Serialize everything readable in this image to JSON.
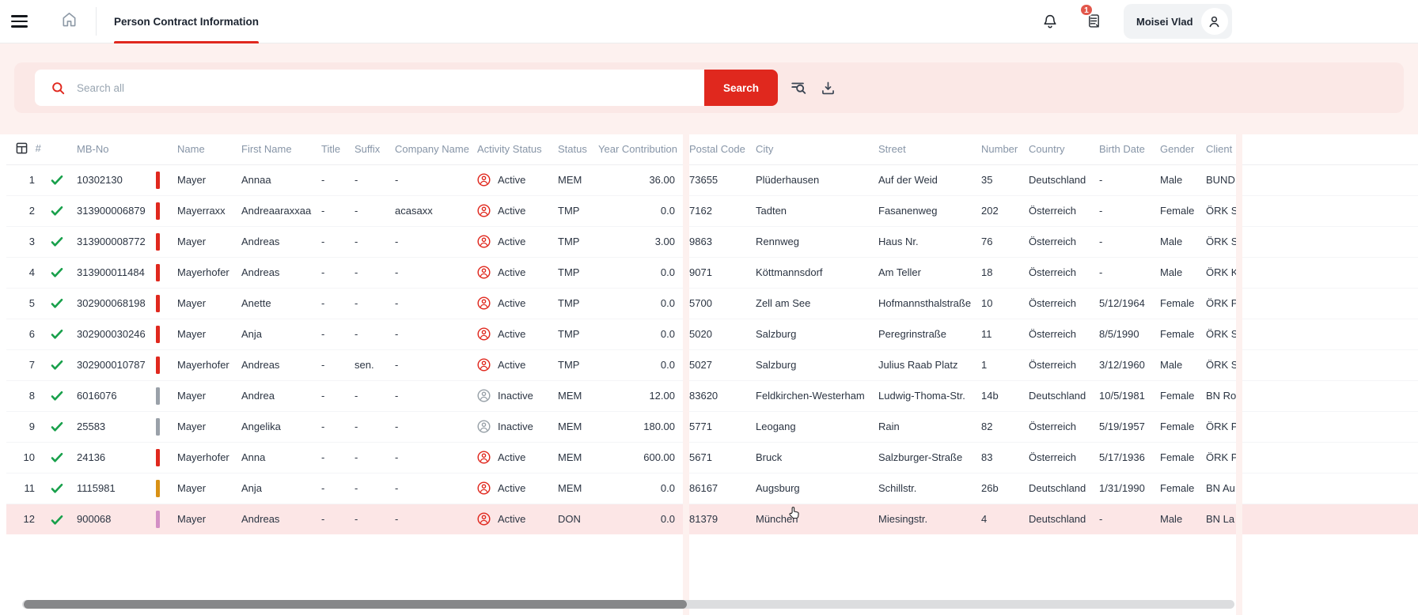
{
  "topbar": {
    "tab_label": "Person Contract Information",
    "user_name": "Moisei Vlad",
    "badge_count": "1"
  },
  "search": {
    "placeholder": "Search all",
    "button_label": "Search"
  },
  "icons": {
    "menu": "hamburger",
    "home": "house-outline",
    "notifications": "bell-outline",
    "tasks": "clipboard-list",
    "user": "person-circle",
    "search": "magnifier",
    "advanced_search": "list-magnifier",
    "download": "tray-arrow-down",
    "column_settings": "table-grid",
    "row_verified": "green-check",
    "activity": "person-in-circle"
  },
  "colors": {
    "accent": "#e0281e",
    "active_status": "#e0281e",
    "inactive_status": "#98a1a8",
    "check_green": "#18a04b",
    "row_highlight": "#fce6e6",
    "search_band": "#fdf1ef",
    "search_panel": "#fbe8e6"
  },
  "table": {
    "columns": [
      "#",
      "MB-No",
      "Name",
      "First Name",
      "Title",
      "Suffix",
      "Company Name",
      "Activity Status",
      "Status",
      "Year Contribution",
      "Postal Code",
      "City",
      "Street",
      "Number",
      "Country",
      "Birth Date",
      "Gender",
      "Client"
    ],
    "rows": [
      {
        "num": "1",
        "mb_no": "10302130",
        "bar_color": "#e0281e",
        "name": "Mayer",
        "first_name": "Annaa",
        "title": "-",
        "suffix": "-",
        "company": "-",
        "activity": "Active",
        "status": "MEM",
        "contribution": "36.00",
        "postal": "73655",
        "city": "Plüderhausen",
        "street": "Auf der Weid",
        "number": "35",
        "country": "Deutschland",
        "birth": "-",
        "gender": "Male",
        "client": "BUND",
        "highlight": false
      },
      {
        "num": "2",
        "mb_no": "313900006879",
        "bar_color": "#e0281e",
        "name": "Mayerraxx",
        "first_name": "Andreaaraxxaa",
        "title": "-",
        "suffix": "-",
        "company": "acasaxx",
        "activity": "Active",
        "status": "TMP",
        "contribution": "0.0",
        "postal": "7162",
        "city": "Tadten",
        "street": "Fasanenweg",
        "number": "202",
        "country": "Österreich",
        "birth": "-",
        "gender": "Female",
        "client": "ÖRK S",
        "highlight": false
      },
      {
        "num": "3",
        "mb_no": "313900008772",
        "bar_color": "#e0281e",
        "name": "Mayer",
        "first_name": "Andreas",
        "title": "-",
        "suffix": "-",
        "company": "-",
        "activity": "Active",
        "status": "TMP",
        "contribution": "3.00",
        "postal": "9863",
        "city": "Rennweg",
        "street": "Haus Nr.",
        "number": "76",
        "country": "Österreich",
        "birth": "-",
        "gender": "Male",
        "client": "ÖRK S",
        "highlight": false
      },
      {
        "num": "4",
        "mb_no": "313900011484",
        "bar_color": "#e0281e",
        "name": "Mayerhofer",
        "first_name": "Andreas",
        "title": "-",
        "suffix": "-",
        "company": "-",
        "activity": "Active",
        "status": "TMP",
        "contribution": "0.0",
        "postal": "9071",
        "city": "Köttmannsdorf",
        "street": "Am Teller",
        "number": "18",
        "country": "Österreich",
        "birth": "-",
        "gender": "Male",
        "client": "ÖRK K",
        "highlight": false
      },
      {
        "num": "5",
        "mb_no": "302900068198",
        "bar_color": "#e0281e",
        "name": "Mayer",
        "first_name": "Anette",
        "title": "-",
        "suffix": "-",
        "company": "-",
        "activity": "Active",
        "status": "TMP",
        "contribution": "0.0",
        "postal": "5700",
        "city": "Zell am See",
        "street": "Hofmannsthalstraße",
        "number": "10",
        "country": "Österreich",
        "birth": "5/12/1964",
        "gender": "Female",
        "client": "ÖRK P",
        "highlight": false
      },
      {
        "num": "6",
        "mb_no": "302900030246",
        "bar_color": "#e0281e",
        "name": "Mayer",
        "first_name": "Anja",
        "title": "-",
        "suffix": "-",
        "company": "-",
        "activity": "Active",
        "status": "TMP",
        "contribution": "0.0",
        "postal": "5020",
        "city": "Salzburg",
        "street": "Peregrinstraße",
        "number": "11",
        "country": "Österreich",
        "birth": "8/5/1990",
        "gender": "Female",
        "client": "ÖRK S",
        "highlight": false
      },
      {
        "num": "7",
        "mb_no": "302900010787",
        "bar_color": "#e0281e",
        "name": "Mayerhofer",
        "first_name": "Andreas",
        "title": "-",
        "suffix": "sen.",
        "company": "-",
        "activity": "Active",
        "status": "TMP",
        "contribution": "0.0",
        "postal": "5027",
        "city": "Salzburg",
        "street": "Julius Raab Platz",
        "number": "1",
        "country": "Österreich",
        "birth": "3/12/1960",
        "gender": "Male",
        "client": "ÖRK S",
        "highlight": false
      },
      {
        "num": "8",
        "mb_no": "6016076",
        "bar_color": "#9aa1a9",
        "name": "Mayer",
        "first_name": "Andrea",
        "title": "-",
        "suffix": "-",
        "company": "-",
        "activity": "Inactive",
        "status": "MEM",
        "contribution": "12.00",
        "postal": "83620",
        "city": "Feldkirchen-Westerham",
        "street": "Ludwig-Thoma-Str.",
        "number": "14b",
        "country": "Deutschland",
        "birth": "10/5/1981",
        "gender": "Female",
        "client": "BN Ro",
        "highlight": false
      },
      {
        "num": "9",
        "mb_no": "25583",
        "bar_color": "#9aa1a9",
        "name": "Mayer",
        "first_name": "Angelika",
        "title": "-",
        "suffix": "-",
        "company": "-",
        "activity": "Inactive",
        "status": "MEM",
        "contribution": "180.00",
        "postal": "5771",
        "city": "Leogang",
        "street": "Rain",
        "number": "82",
        "country": "Österreich",
        "birth": "5/19/1957",
        "gender": "Female",
        "client": "ÖRK P",
        "highlight": false
      },
      {
        "num": "10",
        "mb_no": "24136",
        "bar_color": "#e0281e",
        "name": "Mayerhofer",
        "first_name": "Anna",
        "title": "-",
        "suffix": "-",
        "company": "-",
        "activity": "Active",
        "status": "MEM",
        "contribution": "600.00",
        "postal": "5671",
        "city": "Bruck",
        "street": "Salzburger-Straße",
        "number": "83",
        "country": "Österreich",
        "birth": "5/17/1936",
        "gender": "Female",
        "client": "ÖRK P",
        "highlight": false
      },
      {
        "num": "11",
        "mb_no": "1115981",
        "bar_color": "#d99115",
        "name": "Mayer",
        "first_name": "Anja",
        "title": "-",
        "suffix": "-",
        "company": "-",
        "activity": "Active",
        "status": "MEM",
        "contribution": "0.0",
        "postal": "86167",
        "city": "Augsburg",
        "street": "Schillstr.",
        "number": "26b",
        "country": "Deutschland",
        "birth": "1/31/1990",
        "gender": "Female",
        "client": "BN Au",
        "highlight": false
      },
      {
        "num": "12",
        "mb_no": "900068",
        "bar_color": "#d38fc5",
        "name": "Mayer",
        "first_name": "Andreas",
        "title": "-",
        "suffix": "-",
        "company": "-",
        "activity": "Active",
        "status": "DON",
        "contribution": "0.0",
        "postal": "81379",
        "city": "München",
        "street": "Miesingstr.",
        "number": "4",
        "country": "Deutschland",
        "birth": "-",
        "gender": "Male",
        "client": "BN La",
        "highlight": true
      }
    ]
  }
}
